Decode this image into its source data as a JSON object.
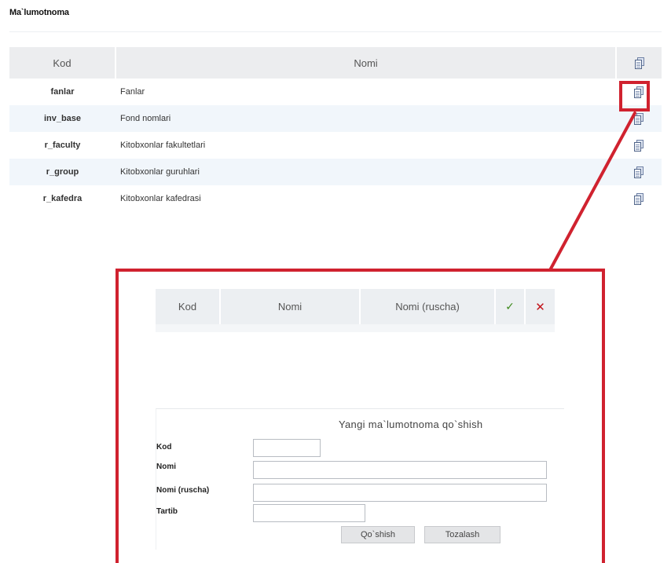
{
  "page": {
    "title": "Ma`lumotnoma"
  },
  "main_table": {
    "headers": {
      "kod": "Kod",
      "nomi": "Nomi",
      "action_icon": "document-icon"
    },
    "rows": [
      {
        "kod": "fanlar",
        "nomi": "Fanlar"
      },
      {
        "kod": "inv_base",
        "nomi": "Fond nomlari"
      },
      {
        "kod": "r_faculty",
        "nomi": "Kitobxonlar fakultetlari"
      },
      {
        "kod": "r_group",
        "nomi": "Kitobxonlar guruhlari"
      },
      {
        "kod": "r_kafedra",
        "nomi": "Kitobxonlar kafedrasi"
      }
    ]
  },
  "callout": {
    "color": "#d0222f"
  },
  "detail": {
    "table_headers": {
      "kod": "Kod",
      "nomi": "Nomi",
      "nomi_ruscha": "Nomi (ruscha)"
    },
    "header_icons": {
      "add": "checkmark-edit-icon",
      "delete": "delete-x-icon"
    },
    "form": {
      "title": "Yangi ma`lumotnoma qo`shish",
      "kod_label": "Kod",
      "nomi_label": "Nomi",
      "nomi_ruscha_label": "Nomi (ruscha)",
      "tartib_label": "Tartib",
      "kod_value": "",
      "nomi_value": "",
      "nomi_ruscha_value": "",
      "tartib_value": "",
      "add_button": "Qo`shish",
      "clear_button": "Tozalash"
    }
  }
}
